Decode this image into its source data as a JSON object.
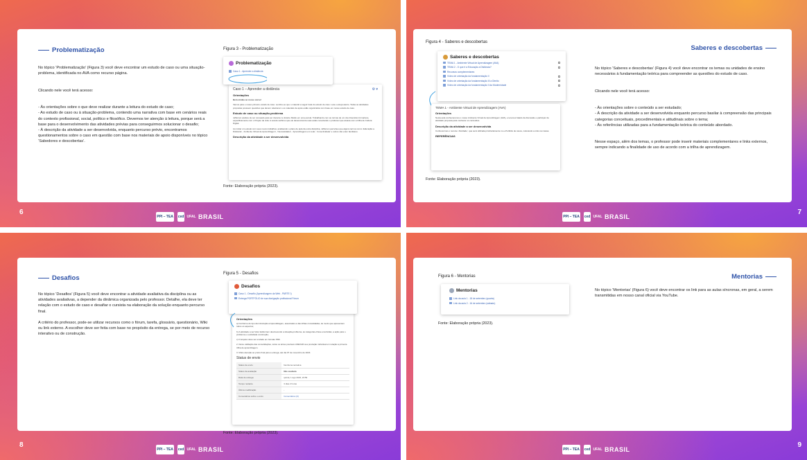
{
  "footer": {
    "logo_mark": "PPI – TEA",
    "logo_ufal": "UFAL",
    "ced": "ced",
    "brasil": "BRASIL"
  },
  "s6": {
    "page": "6",
    "title": "Problematização",
    "paragraphs": [
      "No tópico ‘Problematização’ (Figura 3) você deve encontrar um estudo de caso ou uma situação-problema, identificada no AVA como recurso página.",
      "Clicando nele você terá acesso:",
      "- Às orientações sobre o que deve realizar durante a leitura do estudo de caso;\n- Ao estudo de caso ou à situação-problema, contendo uma narrativa com base em cenários reais do contexto profissional, social, político e filosófico. Devemos ter atenção à leitura, porque será a base para o desenvolvimento das atividades prévias para conseguirmos solucionar o desafio;\n- À descrição da atividade a ser desenvolvida, enquanto percurso prévio, encontramos questionamentos sobre o caso em questão com base nos materiais de apoio disponíveis no tópico ‘Sabedores e descobertas’."
    ],
    "fig": "Figura 3 - Problematização",
    "src": "Fonte: Elaboração própria (2023).",
    "shot_title": "Problematização",
    "shot_link": "Caso 1 - Aprender a distância",
    "shot2_title": "Caso 1 – Aprender a distância",
    "shot2_orient": "Orientações",
    "shot2_welcome": "Bem-vindas ao nosso curso!",
    "shot2_text": "Vamos para o nosso primeiro estudo de caso. Lembre-se que o material a seguir trata do estudo de caso. Leia e esteja atento. Todas as atividades propostas possuem questões que devem relacionar o os materiais de apoio estão organizados com base em nosso estudo de caso.",
    "shot2_case": "Estudo de caso ou situação-problema",
    "shot2_case_text": "Jefferson acabou de ser nomeado para ser docente no Ensino Médio em uma escola. Trabalhando com as turmas de um dos itinerários formativos, especificamente com o Projeto de vida. A escola verificou que ele desenvolveria suas aulas conectando o professor que atuava com a trilha de Cultura Digital.",
    "shot2_case_text2": "Ao iniciar um estudo com seus novos trabalhos, analisando o plano de aula da outra disciplina, Jefferson percebeu que alguns termos como ‘Educação a Distância’, ‘Ambiente Virtual de Aprendizagem’, ‘Necessidades’, ‘Aprendizagens em rede’, ‘Conectividade’ e outros não eram familiares.",
    "shot2_desc": "Descrição da atividade a ser desenvolvida"
  },
  "s7": {
    "page": "7",
    "title": "Saberes e descobertas",
    "paragraphs": [
      "No tópico ‘Saberes e descobertas’ (Figura 4) você deve encontrar os temas ou unidades de ensino necessários à fundamentação teórica para compreender as questões do estudo de caso.",
      "Clicando nele você terá acesso:",
      "- Às orientações sobre o conteúdo a ser estudado;\n- À descrição da atividade a ser desenvolvida enquanto percurso basilar à compreensão das principais categorias conceituais, procedimentais e atitudinais sobre o tema;\n- Às referências utilizadas para a fundamentação teórica do conteúdo abordado.",
      "Nesse espaço, além dos temas, o professor pode inserir materiais complementares e links externos, sempre indicando a finalidade de uso de acordo com a trilha de aprendizagem."
    ],
    "fig": "Figura 4 - Saberes e descobertas",
    "src": "Fonte: Elaboração própria (2023).",
    "shot_title": "Saberes e descobertas",
    "items": [
      "TEMA 1 - Ambiente Virtual de Aprendizagem (AVA)",
      "TEMA 2 - O que é a Educação a Distância?",
      "Recursos complementares",
      "Vídeo de orientação da fundamentação II",
      "Vídeo de orientação da fundamentação III a Direito",
      "Vídeo de orientação da fundamentação II da Modernidade"
    ],
    "shot2_title": "TEMA 1 - Ambiente Virtual de Aprendizagem (AVA)",
    "shot2_orient": "Orientações",
    "shot2_text": "Nesta aula conheceremos o nosso Ambiente Virtual de Aprendizagem (AVA), e teremos falado da discussão e participar da atividade proposta para conhecer os conteúdos.",
    "shot2_desc": "Descrição da atividade a ser desenvolvida",
    "shot2_desc_text": "Conhecermos o recurso ‘Atividade’, que será utilizada prioritariamente no e-Portfólio de casos, colocando a mão na massa.",
    "shot2_ref": "REFERÊNCIAS"
  },
  "s8": {
    "page": "8",
    "title": "Desafios",
    "paragraphs": [
      "No tópico ‘Desafios’ (Figura 5) você deve encontrar a atividade avaliativa da disciplina ou as atividades avaliativas, a depender da dinâmica organizada pelo professor. Detalhe, ela deve ter relação com o estudo de caso e desafiar o cursista na elaboração da solução enquanto percurso final.",
      "A critério do professor, pode-se utilizar recursos como o fórum, tarefa, glossário, questionário, Wiki ou link externo. A escolher deve ser feita com base no propósito da entrega, se por meio de recurso interativo ou de construção."
    ],
    "fig": "Figura 5 - Desafios",
    "src": "Fonte: Elaboração própria (2023).",
    "shot_title": "Desafios",
    "items": [
      "Caso 1 - Desafio (Aprendizagem da Web - PARTE I)",
      "Entrega PORTFÓLIO de sua divulgação profissional Fórum"
    ],
    "shot2_orient": "Orientações",
    "shot2_lines": [
      "a) Conforme do tipo da introdução à Aprendizagem, associados a das trilhas consolidadas, de modo que apresentem todos os aspectos;",
      "b) A atividade a ser feita: Estão bem descrevendo a situação-problema, as categorias-chave envolvidas, a ação para o problema e a atividade construção;",
      "c) O arquivo deve ser enviado em formato PDF.",
      "2. Deixe validação das consolidações, todos os letras precisam ANEXAR sua produção individual em relação à primeira trilha de aprendizagem.",
      "3. Muito atenção ao prazo final para a entrega, até dia 07 de novembro de 2023."
    ],
    "status": "Status de envio",
    "rows": [
      [
        "Status de envio",
        "Nenhuma tentativa"
      ],
      [
        "Status da avaliação",
        "Não avaliada"
      ],
      [
        "Data de entrega",
        "quinta, 1 ago 2023, 23:59"
      ],
      [
        "Tempo restante",
        "3 dias 2 horas"
      ],
      [
        "Última modificação",
        "-"
      ],
      [
        "Comentários sobre o envio",
        "Comentários (0)"
      ]
    ]
  },
  "s9": {
    "page": "9",
    "title": "Mentorias",
    "paragraphs": [
      "No tópico ‘Mentorias’ (Figura 6) você deve encontrar os link para as aulas síncronas, em geral, a serem transmitidas em nosso canal oficial via YouTube."
    ],
    "fig": "Figura 6 - Mentorias",
    "src": "Fonte: Elaboração própria (2023).",
    "shot_title": "Mentorias",
    "items": [
      "Link da aula 1 - 18 de setembro (quarta)",
      "Link da aula 2 - 16 de setembro (sábado)"
    ]
  },
  "colors": {
    "heading": "#2e52a8",
    "link": "#3461b5",
    "gradient_start": "#ef6a4e",
    "gradient_end": "#8a3bd8"
  }
}
